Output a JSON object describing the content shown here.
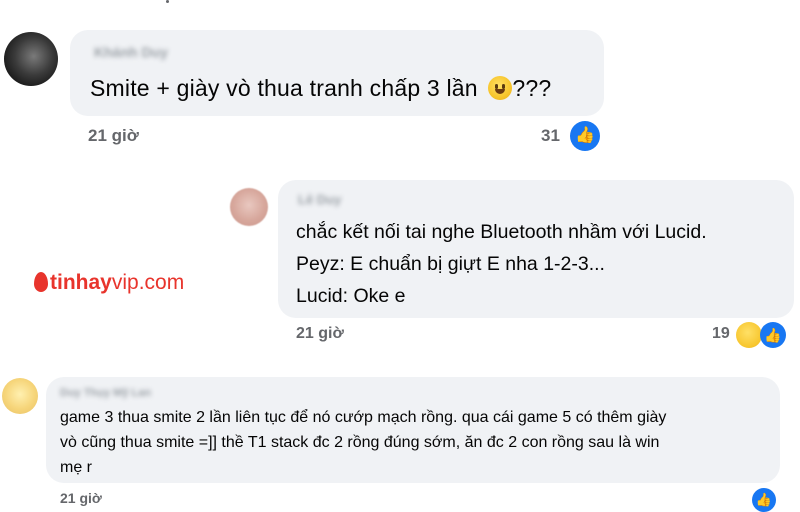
{
  "comments": [
    {
      "author": "Khánh Duy",
      "lines": [
        "Smite + giày vò thua tranh chấp 3 lần",
        "???"
      ],
      "time": "21 giờ",
      "reactions": "31"
    },
    {
      "author": "Lê Duy",
      "lines": [
        "chắc kết nối tai nghe Bluetooth nhầm với Lucid.",
        "Peyz: E chuẩn bị giựt E nha 1-2-3...",
        "Lucid: Oke e"
      ],
      "time": "21 giờ",
      "reactions": "19"
    },
    {
      "author": "Duy Thụy Mỹ Lan",
      "lines": [
        "game 3 thua smite 2 lần liên tục để nó cướp mạch rồng. qua cái game 5 có thêm giày",
        "vò cũng thua smite =]] thề T1 stack đc 2 rồng đúng sớm, ăn đc 2 con rồng sau là win",
        "mẹ r"
      ],
      "time": "21 giờ"
    }
  ],
  "watermark": {
    "part1": "tinhay",
    "part2": "vip.com"
  },
  "icons": {
    "like": "like-icon",
    "haha": "haha-icon",
    "emoji": "grinning-face-icon"
  },
  "colors": {
    "bubble": "#f0f2f5",
    "like": "#1877f2",
    "meta": "#65676b",
    "brand": "#e8342c"
  }
}
